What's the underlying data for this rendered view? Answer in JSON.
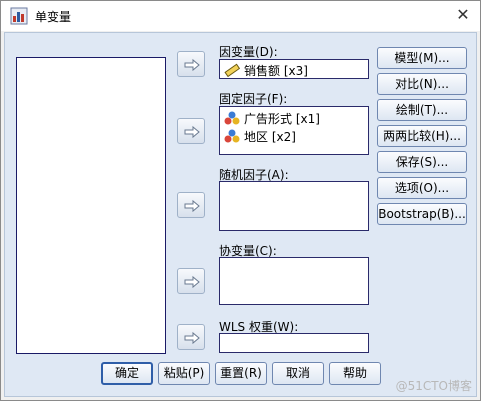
{
  "window": {
    "title": "单变量",
    "close_glyph": "✕"
  },
  "fields": {
    "dependent": {
      "label": "因变量(D):",
      "items": [
        {
          "icon": "ruler-scale-icon",
          "text": "销售额 [x3]"
        }
      ]
    },
    "fixed": {
      "label": "固定因子(F):",
      "items": [
        {
          "icon": "nominal-variable-icon",
          "text": "广告形式 [x1]"
        },
        {
          "icon": "nominal-variable-icon",
          "text": "地区 [x2]"
        }
      ]
    },
    "random": {
      "label": "随机因子(A):",
      "items": []
    },
    "covariate": {
      "label": "协变量(C):",
      "items": []
    },
    "wls": {
      "label": "WLS 权重(W):",
      "items": []
    }
  },
  "side_buttons": [
    "模型(M)...",
    "对比(N)...",
    "绘制(T)...",
    "两两比较(H)...",
    "保存(S)...",
    "选项(O)...",
    "Bootstrap(B)..."
  ],
  "bottom_buttons": [
    "确定",
    "粘贴(P)",
    "重置(R)",
    "取消",
    "帮助"
  ],
  "watermark": "@51CTO博客",
  "colors": {
    "dialog_bg": "#dfe8f4",
    "button_border": "#6f87b0",
    "default_border": "#2f5ea8"
  }
}
